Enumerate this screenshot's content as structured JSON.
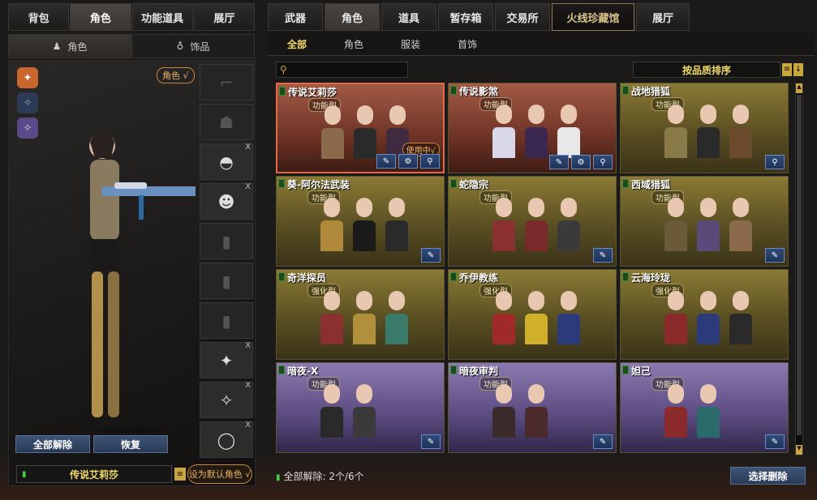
{
  "left": {
    "tabs": [
      "背包",
      "角色",
      "功能道具",
      "展厅"
    ],
    "active_tab": 1,
    "subtabs": [
      {
        "label": "角色",
        "icon": "character-icon"
      },
      {
        "label": "饰品",
        "icon": "ornament-icon"
      }
    ],
    "role_badge": "角色 √",
    "slots": [
      {
        "name": "weapon-slot",
        "mark": "⌐",
        "close": ""
      },
      {
        "name": "helmet-slot",
        "mark": "☗",
        "close": ""
      },
      {
        "name": "goggles-slot",
        "mark": "◓",
        "close": "X"
      },
      {
        "name": "mascot-slot",
        "mark": "☻",
        "close": "X"
      },
      {
        "name": "vest-slot",
        "mark": "▮",
        "close": ""
      },
      {
        "name": "body-slot",
        "mark": "▮",
        "close": ""
      },
      {
        "name": "back-slot",
        "mark": "▮",
        "close": ""
      },
      {
        "name": "bracelet-slot",
        "mark": "✦",
        "close": "X"
      },
      {
        "name": "ring-slot",
        "mark": "✧",
        "close": "X"
      },
      {
        "name": "chain-slot",
        "mark": "◯",
        "close": "X"
      }
    ],
    "unequip_all": "全部解除",
    "restore": "恢复",
    "character_name": "传说艾莉莎",
    "set_default": "设为默认角色 √"
  },
  "right": {
    "tabs": [
      "武器",
      "角色",
      "道具",
      "暂存箱",
      "交易所",
      "火线珍藏馆",
      "展厅"
    ],
    "active_tab": 1,
    "filters": [
      "全部",
      "角色",
      "服装",
      "首饰"
    ],
    "active_filter": 0,
    "search_placeholder": "",
    "sort_label": "按品质排序",
    "cards": [
      {
        "title": "传说艾莉莎",
        "type": "功能型",
        "theme": "red",
        "selected": true,
        "in_use": "使用中√",
        "buttons": 3,
        "colors": [
          "#8a6a4a",
          "#2a2a2a",
          "#402a40"
        ]
      },
      {
        "title": "传说影煞",
        "type": "功能型",
        "theme": "red",
        "selected": false,
        "in_use": "",
        "buttons": 3,
        "colors": [
          "#d8d8e8",
          "#3a2850",
          "#e8e8e8"
        ]
      },
      {
        "title": "战地猎狐",
        "type": "功能型",
        "theme": "gold",
        "selected": false,
        "in_use": "",
        "buttons": 1,
        "colors": [
          "#8a7a4a",
          "#2a2a2a",
          "#6a4a2a"
        ]
      },
      {
        "title": "葵-阿尔法武装",
        "type": "功能型",
        "theme": "gold",
        "selected": false,
        "in_use": "",
        "buttons": 1,
        "colors": [
          "#b08a3a",
          "#1a1a1a",
          "#2a2a2a"
        ]
      },
      {
        "title": "蛇隐宗",
        "type": "功能型",
        "theme": "gold",
        "selected": false,
        "in_use": "",
        "buttons": 1,
        "colors": [
          "#8a3030",
          "#7a2a2a",
          "#3a3a3a"
        ]
      },
      {
        "title": "西域猎狐",
        "type": "功能型",
        "theme": "gold",
        "selected": false,
        "in_use": "",
        "buttons": 1,
        "colors": [
          "#6a5a3a",
          "#5a4a7a",
          "#8a6a4a"
        ]
      },
      {
        "title": "奇洋探员",
        "type": "强化型",
        "theme": "gold",
        "selected": false,
        "in_use": "",
        "buttons": 0,
        "colors": [
          "#8a3030",
          "#b0903a",
          "#3a7a6a"
        ]
      },
      {
        "title": "乔伊教练",
        "type": "强化型",
        "theme": "gold",
        "selected": false,
        "in_use": "",
        "buttons": 0,
        "colors": [
          "#a02a2a",
          "#d0b02a",
          "#2a3a7a"
        ]
      },
      {
        "title": "云海玲珑",
        "type": "强化型",
        "theme": "gold",
        "selected": false,
        "in_use": "",
        "buttons": 0,
        "colors": [
          "#8a2a2a",
          "#2a3a7a",
          "#2a2a2a"
        ]
      },
      {
        "title": "暗夜-X",
        "type": "功能型",
        "theme": "purple",
        "selected": false,
        "in_use": "",
        "buttons": 1,
        "colors": [
          "#2a2a2a",
          "#3a3a3a"
        ]
      },
      {
        "title": "暗夜审判",
        "type": "功能型",
        "theme": "purple",
        "selected": false,
        "in_use": "",
        "buttons": 1,
        "colors": [
          "#3a2a2a",
          "#4a2a2a"
        ]
      },
      {
        "title": "妲己",
        "type": "功能型",
        "theme": "purple",
        "selected": false,
        "in_use": "",
        "buttons": 1,
        "colors": [
          "#8a2a2a",
          "#2a6a6a"
        ]
      }
    ],
    "unlock_text": "全部解除: 2个/6个",
    "delete_button": "选择删除"
  }
}
